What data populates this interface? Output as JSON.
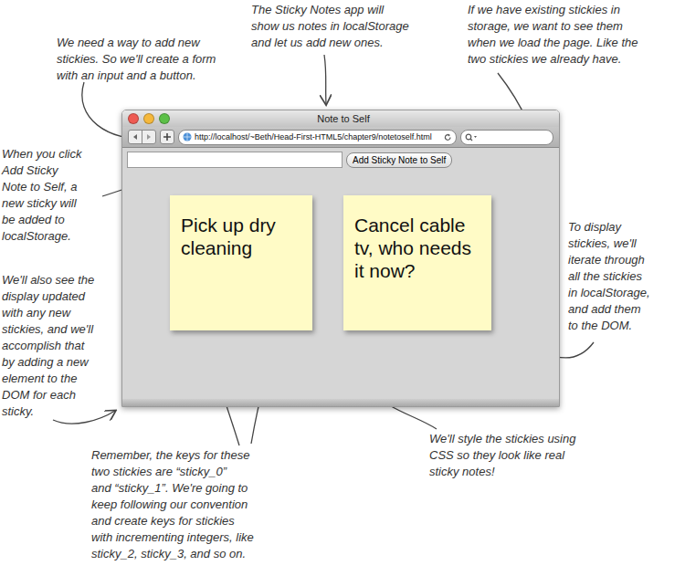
{
  "annotations": [
    {
      "lines": [
        "The Sticky Notes app will",
        "show us notes in localStorage",
        "and let us add new ones."
      ]
    },
    {
      "lines": [
        "We need a way to add new",
        "stickies. So we'll create a form",
        "with an input and a button."
      ]
    },
    {
      "lines": [
        "If we have existing stickies in",
        "storage, we want to see them",
        "when we load the page. Like the",
        "two stickies we already have."
      ]
    },
    {
      "lines": [
        "When you click",
        "Add Sticky",
        "Note to Self, a",
        "new sticky will",
        "be added to",
        "localStorage."
      ]
    },
    {
      "lines": [
        "We'll also see the",
        "display updated",
        "with any new",
        "stickies, and we'll",
        "accomplish that",
        "by adding a new",
        "element to the",
        "DOM for each",
        "sticky."
      ]
    },
    {
      "lines": [
        "To display",
        "stickies, we'll",
        "iterate through",
        "all the stickies",
        "in localStorage,",
        "and add them",
        "to the DOM."
      ]
    },
    {
      "lines": [
        "Remember, the keys for these",
        "two stickies are “sticky_0”",
        "and “sticky_1”. We're going to",
        "keep following our convention",
        "and create keys for stickies",
        "with incrementing integers, like",
        "sticky_2, sticky_3, and so on."
      ]
    },
    {
      "lines": [
        "We'll style the stickies using",
        "CSS so they look like real",
        "sticky notes!"
      ]
    }
  ],
  "window": {
    "title": "Note to Self",
    "url": "http://localhost/~Beth/Head-First-HTML5/chapter9/notetoself.html"
  },
  "form": {
    "value": "",
    "button": "Add Sticky Note to Self"
  },
  "stickies": [
    {
      "text": "Pick up dry cleaning"
    },
    {
      "text": "Cancel cable tv, who needs it now?"
    }
  ]
}
